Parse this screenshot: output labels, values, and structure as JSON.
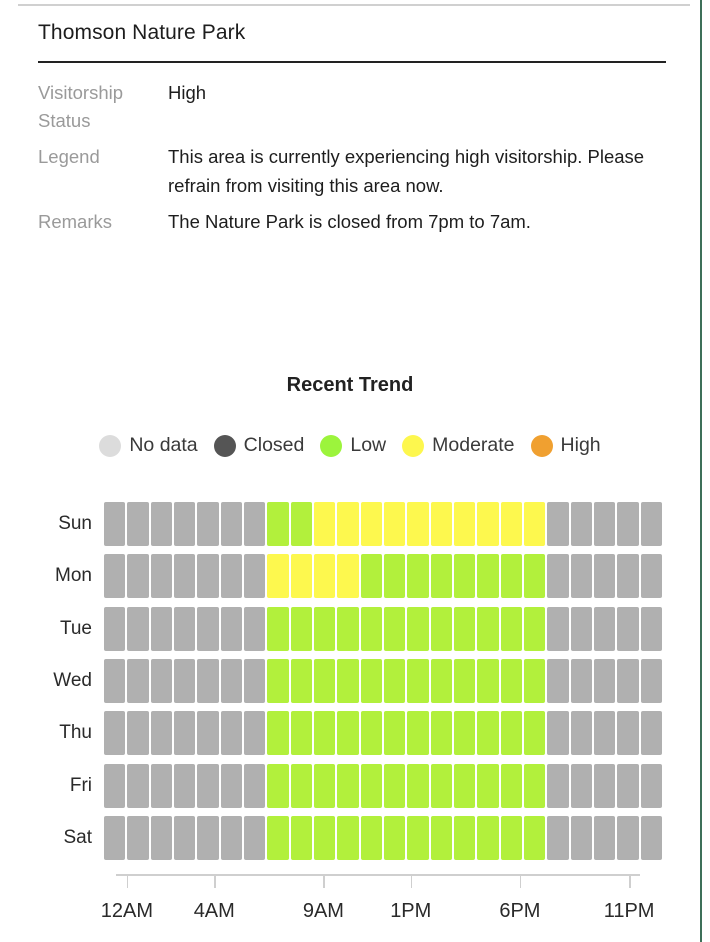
{
  "park": {
    "title": "Thomson Nature Park",
    "fields": [
      {
        "key": "Visitorship Status",
        "value": "High"
      },
      {
        "key": "Legend",
        "value": "This area is currently experiencing high visitorship. Please refrain from visiting this area now."
      },
      {
        "key": "Remarks",
        "value": "The Nature Park is closed from 7pm to 7am."
      }
    ]
  },
  "chart": {
    "title": "Recent Trend",
    "legend": [
      {
        "label": "No data",
        "color": "#dcdcdc"
      },
      {
        "label": "Closed",
        "color": "#555555"
      },
      {
        "label": "Low",
        "color": "#9cf43c"
      },
      {
        "label": "Moderate",
        "color": "#fdf74e"
      },
      {
        "label": "High",
        "color": "#f0a030"
      }
    ]
  },
  "colors": {
    "no_data": "#dcdcdc",
    "closed": "#b0b0b0",
    "low": "#b2f03c",
    "moderate": "#fdf84e",
    "high": "#f0a030",
    "accent_green": "#3d7059"
  },
  "chart_data": {
    "type": "heatmap",
    "title": "Recent Trend",
    "xlabel": "",
    "ylabel": "",
    "x_tick_labels": [
      "12AM",
      "4AM",
      "9AM",
      "1PM",
      "6PM",
      "11PM"
    ],
    "x_tick_hours": [
      0,
      4,
      9,
      13,
      18,
      23
    ],
    "categories_x": [
      "12AM",
      "1AM",
      "2AM",
      "3AM",
      "4AM",
      "5AM",
      "6AM",
      "7AM",
      "8AM",
      "9AM",
      "10AM",
      "11AM",
      "12PM",
      "1PM",
      "2PM",
      "3PM",
      "4PM",
      "5PM",
      "6PM",
      "7PM",
      "8PM",
      "9PM",
      "10PM",
      "11PM"
    ],
    "categories_y": [
      "Sun",
      "Mon",
      "Tue",
      "Wed",
      "Thu",
      "Fri",
      "Sat"
    ],
    "value_levels": [
      "closed",
      "low",
      "moderate",
      "high",
      "no_data"
    ],
    "level_colors": {
      "closed": "#b0b0b0",
      "low": "#b2f03c",
      "moderate": "#fdf84e",
      "high": "#f0a030",
      "no_data": "#dcdcdc"
    },
    "rows": [
      {
        "day": "Sun",
        "values": [
          "closed",
          "closed",
          "closed",
          "closed",
          "closed",
          "closed",
          "closed",
          "low",
          "low",
          "moderate",
          "moderate",
          "moderate",
          "moderate",
          "moderate",
          "moderate",
          "moderate",
          "moderate",
          "moderate",
          "moderate",
          "closed",
          "closed",
          "closed",
          "closed",
          "closed"
        ]
      },
      {
        "day": "Mon",
        "values": [
          "closed",
          "closed",
          "closed",
          "closed",
          "closed",
          "closed",
          "closed",
          "moderate",
          "moderate",
          "moderate",
          "moderate",
          "low",
          "low",
          "low",
          "low",
          "low",
          "low",
          "low",
          "low",
          "closed",
          "closed",
          "closed",
          "closed",
          "closed"
        ]
      },
      {
        "day": "Tue",
        "values": [
          "closed",
          "closed",
          "closed",
          "closed",
          "closed",
          "closed",
          "closed",
          "low",
          "low",
          "low",
          "low",
          "low",
          "low",
          "low",
          "low",
          "low",
          "low",
          "low",
          "low",
          "closed",
          "closed",
          "closed",
          "closed",
          "closed"
        ]
      },
      {
        "day": "Wed",
        "values": [
          "closed",
          "closed",
          "closed",
          "closed",
          "closed",
          "closed",
          "closed",
          "low",
          "low",
          "low",
          "low",
          "low",
          "low",
          "low",
          "low",
          "low",
          "low",
          "low",
          "low",
          "closed",
          "closed",
          "closed",
          "closed",
          "closed"
        ]
      },
      {
        "day": "Thu",
        "values": [
          "closed",
          "closed",
          "closed",
          "closed",
          "closed",
          "closed",
          "closed",
          "low",
          "low",
          "low",
          "low",
          "low",
          "low",
          "low",
          "low",
          "low",
          "low",
          "low",
          "low",
          "closed",
          "closed",
          "closed",
          "closed",
          "closed"
        ]
      },
      {
        "day": "Fri",
        "values": [
          "closed",
          "closed",
          "closed",
          "closed",
          "closed",
          "closed",
          "closed",
          "low",
          "low",
          "low",
          "low",
          "low",
          "low",
          "low",
          "low",
          "low",
          "low",
          "low",
          "low",
          "closed",
          "closed",
          "closed",
          "closed",
          "closed"
        ]
      },
      {
        "day": "Sat",
        "values": [
          "closed",
          "closed",
          "closed",
          "closed",
          "closed",
          "closed",
          "closed",
          "low",
          "low",
          "low",
          "low",
          "low",
          "low",
          "low",
          "low",
          "low",
          "low",
          "low",
          "low",
          "closed",
          "closed",
          "closed",
          "closed",
          "closed"
        ]
      }
    ]
  }
}
